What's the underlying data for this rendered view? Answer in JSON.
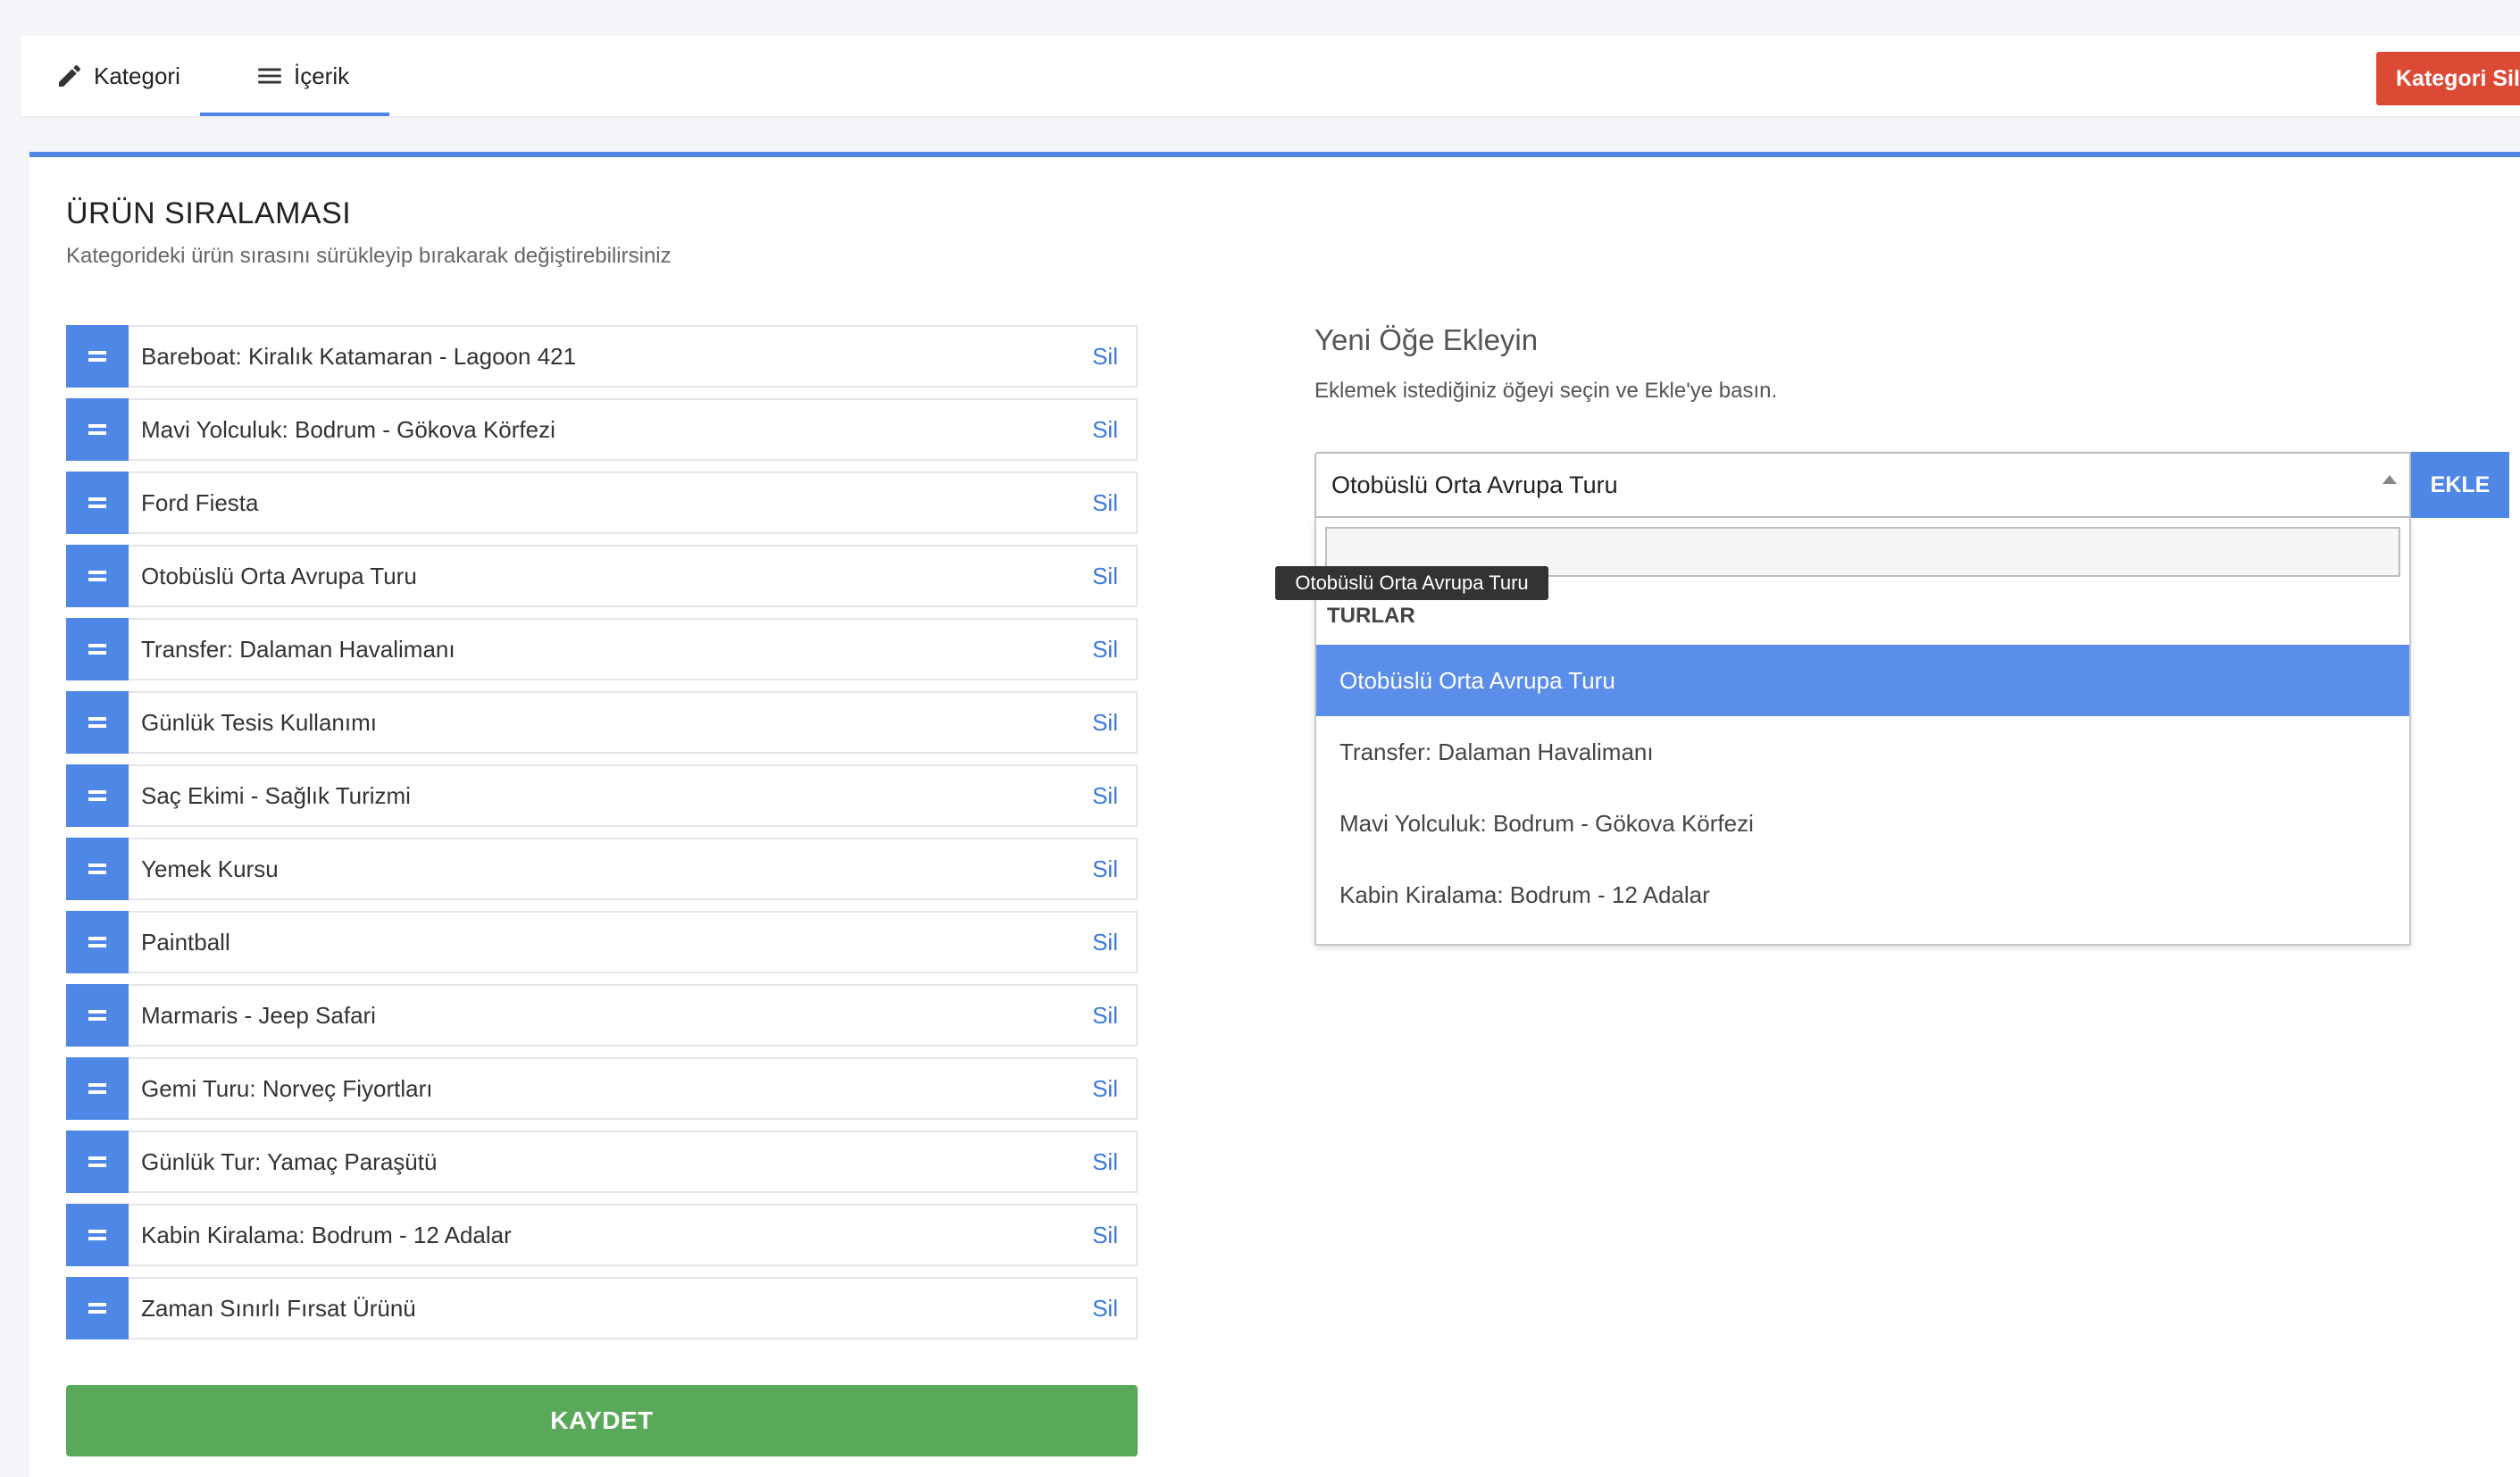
{
  "tabs": {
    "kategori": "Kategori",
    "icerik": "İçerik",
    "delete_category": "Kategori Sil"
  },
  "section": {
    "title": "ÜRÜN SIRALAMASI",
    "description": "Kategorideki ürün sırasını sürükleyip bırakarak değiştirebilirsiniz"
  },
  "products": [
    {
      "name": "Bareboat: Kiralık Katamaran - Lagoon 421",
      "delete": "Sil"
    },
    {
      "name": "Mavi Yolculuk: Bodrum - Gökova Körfezi",
      "delete": "Sil"
    },
    {
      "name": "Ford Fiesta",
      "delete": "Sil"
    },
    {
      "name": "Otobüslü Orta Avrupa Turu",
      "delete": "Sil"
    },
    {
      "name": "Transfer: Dalaman Havalimanı",
      "delete": "Sil"
    },
    {
      "name": "Günlük Tesis Kullanımı",
      "delete": "Sil"
    },
    {
      "name": "Saç Ekimi - Sağlık Turizmi",
      "delete": "Sil"
    },
    {
      "name": "Yemek Kursu",
      "delete": "Sil"
    },
    {
      "name": "Paintball",
      "delete": "Sil"
    },
    {
      "name": "Marmaris - Jeep Safari",
      "delete": "Sil"
    },
    {
      "name": "Gemi Turu: Norveç Fiyortları",
      "delete": "Sil"
    },
    {
      "name": "Günlük Tur: Yamaç Paraşütü",
      "delete": "Sil"
    },
    {
      "name": "Kabin Kiralama: Bodrum - 12 Adalar",
      "delete": "Sil"
    },
    {
      "name": "Zaman Sınırlı Fırsat Ürünü",
      "delete": "Sil"
    }
  ],
  "save_label": "KAYDET",
  "add_item": {
    "title": "Yeni Öğe Ekleyin",
    "description": "Eklemek istediğiniz öğeyi seçin ve Ekle'ye basın.",
    "selected_value": "Otobüslü Orta Avrupa Turu",
    "add_button": "EKLE",
    "search_value": "",
    "tooltip": "Otobüslü Orta Avrupa Turu",
    "group_label": "TURLAR",
    "options": [
      "Otobüslü Orta Avrupa Turu",
      "Transfer: Dalaman Havalimanı",
      "Mavi Yolculuk: Bodrum - Gökova Körfezi",
      "Kabin Kiralama: Bodrum - 12 Adalar"
    ]
  },
  "colors": {
    "accent": "#4e87e5",
    "danger": "#dc4a36",
    "success": "#5aa95a",
    "highlight": "#5b8ee8"
  }
}
